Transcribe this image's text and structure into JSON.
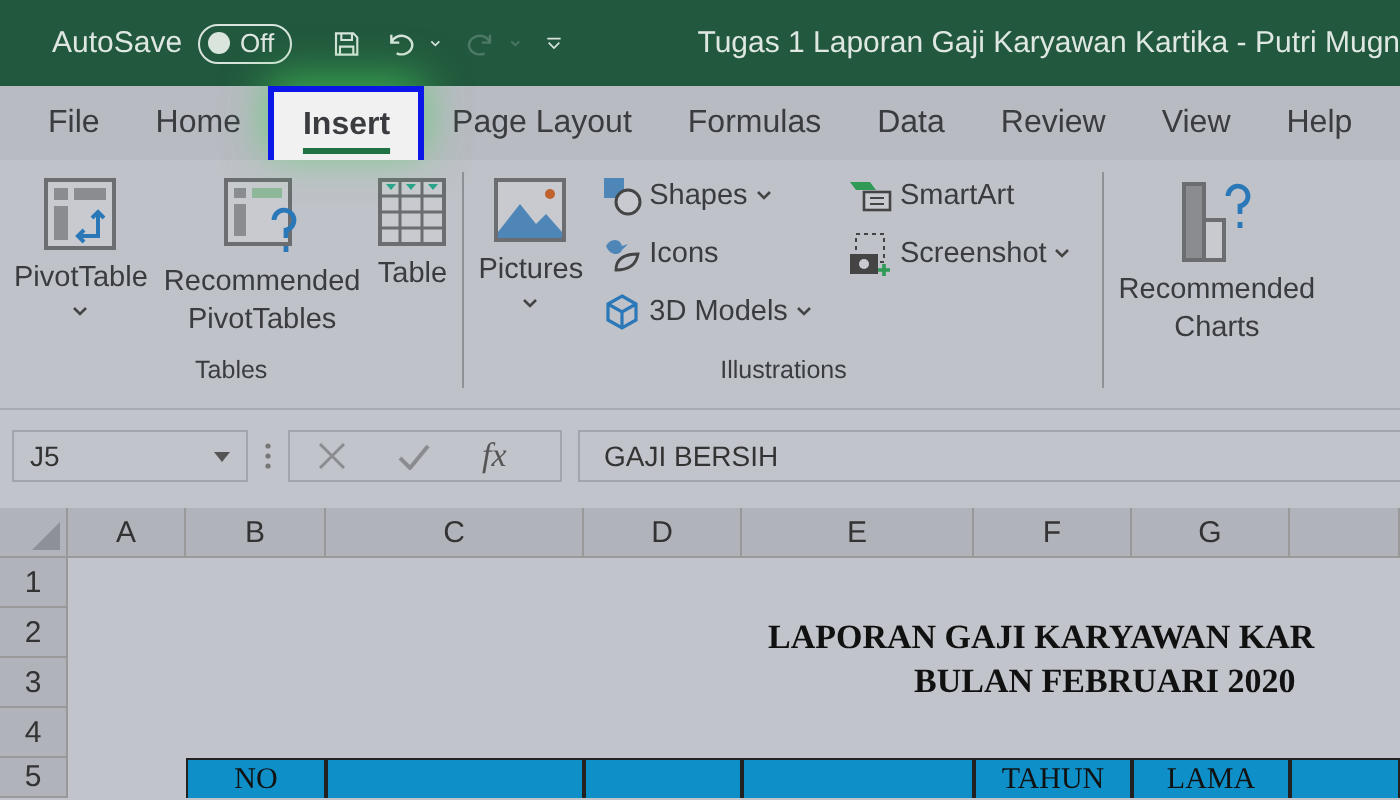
{
  "title_bar": {
    "autosave_label": "AutoSave",
    "autosave_toggle": {
      "label": "Off",
      "on": false
    },
    "document_title": "Tugas 1 Laporan Gaji Karyawan Kartika - Putri Mugn"
  },
  "tabs": [
    {
      "label": "File",
      "selected": false
    },
    {
      "label": "Home",
      "selected": false
    },
    {
      "label": "Insert",
      "selected": true
    },
    {
      "label": "Page Layout",
      "selected": false
    },
    {
      "label": "Formulas",
      "selected": false
    },
    {
      "label": "Data",
      "selected": false
    },
    {
      "label": "Review",
      "selected": false
    },
    {
      "label": "View",
      "selected": false
    },
    {
      "label": "Help",
      "selected": false
    }
  ],
  "ribbon": {
    "groups": [
      {
        "label": "Tables",
        "buttons": [
          {
            "kind": "pivot-table",
            "label": "PivotTable",
            "dropdown": true
          },
          {
            "kind": "recommended-pivot",
            "label": "Recommended PivotTables",
            "dropdown": false
          },
          {
            "kind": "table",
            "label": "Table",
            "dropdown": false
          }
        ]
      },
      {
        "label": "Illustrations",
        "buttons": [
          {
            "kind": "pictures",
            "label": "Pictures",
            "dropdown": true
          }
        ],
        "small_columns": [
          [
            {
              "kind": "shapes",
              "label": "Shapes",
              "dropdown": true
            },
            {
              "kind": "icons",
              "label": "Icons",
              "dropdown": false
            },
            {
              "kind": "models",
              "label": "3D Models",
              "dropdown": true
            }
          ],
          [
            {
              "kind": "smartart",
              "label": "SmartArt",
              "dropdown": false
            },
            {
              "kind": "screenshot",
              "label": "Screenshot",
              "dropdown": true
            }
          ]
        ]
      },
      {
        "buttons": [
          {
            "kind": "recommended-charts",
            "label": "Recommended Charts",
            "dropdown": false
          }
        ]
      }
    ]
  },
  "formula_bar": {
    "name_box": "J5",
    "function_label": "fx",
    "formula": "GAJI BERSIH"
  },
  "sheet": {
    "columns": [
      "A",
      "B",
      "C",
      "D",
      "E",
      "F",
      "G"
    ],
    "row_numbers": [
      "1",
      "2",
      "3",
      "4",
      "5"
    ],
    "title": "LAPORAN GAJI KARYAWAN KAR",
    "subtitle": "BULAN FEBRUARI 2020",
    "header_cells": [
      {
        "text": "NO"
      },
      {},
      {},
      {},
      {
        "text": "TAHUN"
      },
      {
        "text": "LAMA"
      },
      {}
    ]
  }
}
